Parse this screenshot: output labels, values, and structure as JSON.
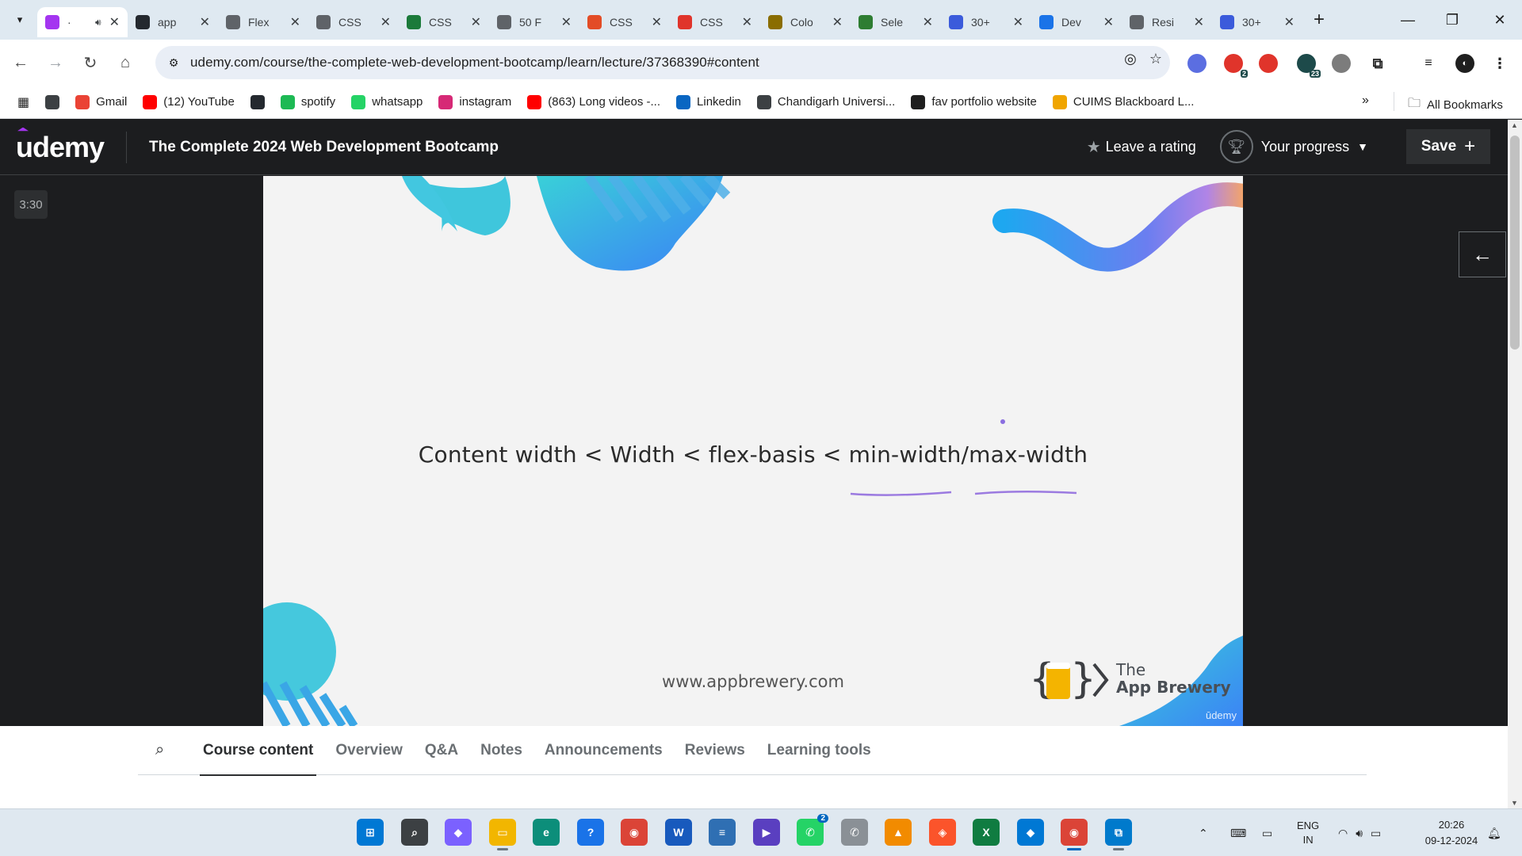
{
  "browser": {
    "tabs": [
      {
        "label": "·",
        "color": "#a435f0",
        "active": true,
        "audio": true
      },
      {
        "label": "app",
        "color": "#24292f"
      },
      {
        "label": "Flex",
        "color": "#5f6368"
      },
      {
        "label": "CSS",
        "color": "#5f6368"
      },
      {
        "label": "CSS",
        "color": "#1b7a3a"
      },
      {
        "label": "50 F",
        "color": "#5f6368"
      },
      {
        "label": "CSS",
        "color": "#e34c26"
      },
      {
        "label": "CSS",
        "color": "#e0342b"
      },
      {
        "label": "Colo",
        "color": "#8a6d00"
      },
      {
        "label": "Sele",
        "color": "#2e7d32"
      },
      {
        "label": "30+",
        "color": "#3b5bdb"
      },
      {
        "label": "Dev",
        "color": "#1a73e8"
      },
      {
        "label": "Resi",
        "color": "#5f6368"
      },
      {
        "label": "30+",
        "color": "#3b5bdb"
      }
    ],
    "url": "udemy.com/course/the-complete-web-development-bootcamp/learn/lecture/37368390#content",
    "extensions": [
      {
        "name": "cursor-ext-icon",
        "color": "#5b6ee1",
        "badge": ""
      },
      {
        "name": "adblock-icon",
        "color": "#e0342b",
        "badge": "2"
      },
      {
        "name": "youtube-ext-icon",
        "color": "#e0342b",
        "badge": ""
      },
      {
        "name": "calendar-ext-icon",
        "color": "#1d4a4a",
        "badge": "23"
      },
      {
        "name": "bug-ext-icon",
        "color": "#7c7c7c",
        "badge": ""
      }
    ],
    "bookmarks": [
      {
        "label": "",
        "icon": "globe-icon",
        "color": "#3c4043"
      },
      {
        "label": "Gmail",
        "icon": "gmail-icon",
        "color": "#ea4335"
      },
      {
        "label": "(12) YouTube",
        "icon": "youtube-icon",
        "color": "#ff0000"
      },
      {
        "label": "",
        "icon": "github-icon",
        "color": "#24292f"
      },
      {
        "label": "spotify",
        "icon": "spotify-icon",
        "color": "#1db954"
      },
      {
        "label": "whatsapp",
        "icon": "whatsapp-icon",
        "color": "#25d366"
      },
      {
        "label": "instagram",
        "icon": "instagram-icon",
        "color": "#d62976"
      },
      {
        "label": "(863) Long videos -...",
        "icon": "youtube-icon",
        "color": "#ff0000"
      },
      {
        "label": "Linkedin",
        "icon": "linkedin-icon",
        "color": "#0a66c2"
      },
      {
        "label": "Chandigarh Universi...",
        "icon": "globe-icon",
        "color": "#3c4043"
      },
      {
        "label": "fav portfolio website",
        "icon": "notion-icon",
        "color": "#1f1f1f"
      },
      {
        "label": "CUIMS Blackboard L...",
        "icon": "pencil-icon",
        "color": "#f0a500"
      }
    ],
    "all_bookmarks": "All Bookmarks"
  },
  "udemy": {
    "logo": "udemy",
    "course_title": "The Complete 2024 Web Development Bootcamp",
    "leave_rating": "Leave a rating",
    "your_progress": "Your progress",
    "save": "Save"
  },
  "video": {
    "timecode": "3:30",
    "slide_text": "Content width < Width < flex-basis < min-width/max-width",
    "slide_url": "www.appbrewery.com",
    "brand_line1": "The",
    "brand_line2": "App Brewery",
    "watermark": "ūdemy"
  },
  "course_tabs": [
    "Course content",
    "Overview",
    "Q&A",
    "Notes",
    "Announcements",
    "Reviews",
    "Learning tools"
  ],
  "taskbar": {
    "apps": [
      {
        "name": "windows-start-icon",
        "color": "#0078d4",
        "glyph": "⊞"
      },
      {
        "name": "search-icon",
        "color": "#3c4043",
        "glyph": "⌕"
      },
      {
        "name": "copilot-icon",
        "color": "#7b61ff",
        "glyph": "◆"
      },
      {
        "name": "file-explorer-icon",
        "color": "#f2b600",
        "glyph": "▭"
      },
      {
        "name": "edge-icon",
        "color": "#0c8e7a",
        "glyph": "e"
      },
      {
        "name": "help-icon",
        "color": "#1a73e8",
        "glyph": "?"
      },
      {
        "name": "chrome-icon",
        "color": "#db4437",
        "glyph": "◉"
      },
      {
        "name": "word-icon",
        "color": "#185abd",
        "glyph": "W"
      },
      {
        "name": "notepad-icon",
        "color": "#2f6fb3",
        "glyph": "≡"
      },
      {
        "name": "media-player-icon",
        "color": "#5a3fc0",
        "glyph": "▶"
      },
      {
        "name": "whatsapp-icon",
        "color": "#25d366",
        "glyph": "✆"
      },
      {
        "name": "whatsapp-alt-icon",
        "color": "#8a9096",
        "glyph": "✆"
      },
      {
        "name": "vlc-icon",
        "color": "#f28b00",
        "glyph": "▲"
      },
      {
        "name": "brave-icon",
        "color": "#fb542b",
        "glyph": "◈"
      },
      {
        "name": "excel-icon",
        "color": "#107c41",
        "glyph": "X"
      },
      {
        "name": "defender-icon",
        "color": "#0078d4",
        "glyph": "◆"
      },
      {
        "name": "chrome-active-icon",
        "color": "#db4437",
        "glyph": "◉"
      },
      {
        "name": "vscode-icon",
        "color": "#007acc",
        "glyph": "⧉"
      }
    ],
    "whatsapp_badge": "2",
    "language": "ENG",
    "region": "IN",
    "time": "20:26",
    "date": "09-12-2024"
  }
}
